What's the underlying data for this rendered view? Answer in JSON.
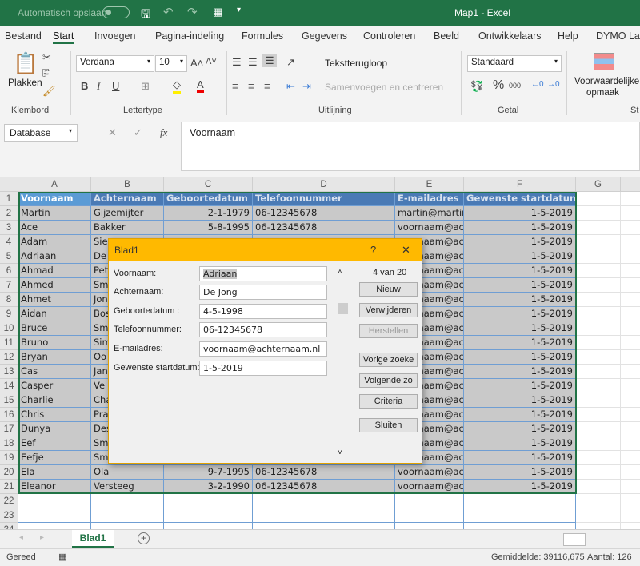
{
  "titlebar": {
    "autosave": "Automatisch opslaan",
    "title": "Map1  -  Excel"
  },
  "tabs": [
    "Bestand",
    "Start",
    "Invoegen",
    "Pagina-indeling",
    "Formules",
    "Gegevens",
    "Controleren",
    "Beeld",
    "Ontwikkelaars",
    "Help",
    "DYMO Lab"
  ],
  "ribbon": {
    "paste": "Plakken",
    "font": "Verdana",
    "size": "10",
    "wrap": "Tekstterugloop",
    "merge": "Samenvoegen en centreren",
    "numfmt": "Standaard",
    "cond1": "Voorwaardelijke",
    "cond2": "opmaak",
    "groups": [
      "Klembord",
      "Lettertype",
      "Uitlijning",
      "Getal",
      "St"
    ]
  },
  "formula": {
    "namebox": "Database",
    "fx": "fx",
    "content": "Voornaam"
  },
  "columns": [
    "A",
    "B",
    "C",
    "D",
    "E",
    "F",
    "G"
  ],
  "rows": [
    [
      "Voornaam",
      "Achternaam",
      "Geboortedatum",
      "Telefoonnummer",
      "E-mailadres",
      "Gewenste startdatum"
    ],
    [
      "Martin",
      "Gijzemijter",
      "2-1-1979",
      "06-12345678",
      "martin@martin",
      "1-5-2019"
    ],
    [
      "Ace",
      "Bakker",
      "5-8-1995",
      "06-12345678",
      "voornaam@achternaam.nl",
      "1-5-2019"
    ],
    [
      "Adam",
      "Sie",
      "",
      "",
      "voornaam@achternaam.nl",
      "1-5-2019"
    ],
    [
      "Adriaan",
      "De",
      "",
      "",
      "voornaam@achternaam.nl",
      "1-5-2019"
    ],
    [
      "Ahmad",
      "Pet",
      "",
      "",
      "voornaam@achternaam.nl",
      "1-5-2019"
    ],
    [
      "Ahmed",
      "Sm",
      "",
      "",
      "voornaam@achternaam.nl",
      "1-5-2019"
    ],
    [
      "Ahmet",
      "Jon",
      "",
      "",
      "voornaam@achternaam.nl",
      "1-5-2019"
    ],
    [
      "Aidan",
      "Bos",
      "",
      "",
      "voornaam@achternaam.nl",
      "1-5-2019"
    ],
    [
      "Bruce",
      "Sm",
      "",
      "",
      "voornaam@achternaam.nl",
      "1-5-2019"
    ],
    [
      "Bruno",
      "Sim",
      "",
      "",
      "voornaam@achternaam.nl",
      "1-5-2019"
    ],
    [
      "Bryan",
      "Oo",
      "",
      "",
      "voornaam@achternaam.nl",
      "1-5-2019"
    ],
    [
      "Cas",
      "Jan",
      "",
      "",
      "voornaam@achternaam.nl",
      "1-5-2019"
    ],
    [
      "Casper",
      "Ve",
      "",
      "",
      "voornaam@achternaam.nl",
      "1-5-2019"
    ],
    [
      "Charlie",
      "Cha",
      "",
      "",
      "voornaam@achternaam.nl",
      "1-5-2019"
    ],
    [
      "Chris",
      "Pra",
      "",
      "",
      "voornaam@achternaam.nl",
      "1-5-2019"
    ],
    [
      "Dunya",
      "Des",
      "",
      "",
      "voornaam@achternaam.nl",
      "1-5-2019"
    ],
    [
      "Eef",
      "Sm",
      "",
      "",
      "voornaam@achternaam.nl",
      "1-5-2019"
    ],
    [
      "Eefje",
      "Sm",
      "",
      "",
      "voornaam@achternaam.nl",
      "1-5-2019"
    ],
    [
      "Ela",
      "Ola",
      "9-7-1995",
      "06-12345678",
      "voornaam@achternaam.nl",
      "1-5-2019"
    ],
    [
      "Eleanor",
      "Versteeg",
      "3-2-1990",
      "06-12345678",
      "voornaam@achternaam.nl",
      "1-5-2019"
    ]
  ],
  "extra_rows": [
    "22",
    "23",
    "24"
  ],
  "dialog": {
    "title": "Blad1",
    "help": "?",
    "close": "✕",
    "record": "4 van 20",
    "fields": [
      {
        "label": "Voornaam:",
        "value": "Adriaan"
      },
      {
        "label": "Achternaam:",
        "value": "De Jong"
      },
      {
        "label": "Geboortedatum :",
        "value": "4-5-1998"
      },
      {
        "label": "Telefoonnummer:",
        "value": "06-12345678"
      },
      {
        "label": "E-mailadres:",
        "value": "voornaam@achternaam.nl"
      },
      {
        "label": "Gewenste startdatum:",
        "value": "1-5-2019"
      }
    ],
    "buttons": [
      "Nieuw",
      "Verwijderen",
      "Herstellen",
      "Vorige zoeke",
      "Volgende zo",
      "Criteria",
      "Sluiten"
    ]
  },
  "sheet": {
    "tab": "Blad1"
  },
  "status": {
    "ready": "Gereed",
    "average": "Gemiddelde: 39116,675",
    "count": "Aantal: 126"
  },
  "colors": {
    "brand": "#217346",
    "dialog_title": "#ffb900",
    "header_fill": "#4a7ab5",
    "selection": "#c9c9c9"
  }
}
